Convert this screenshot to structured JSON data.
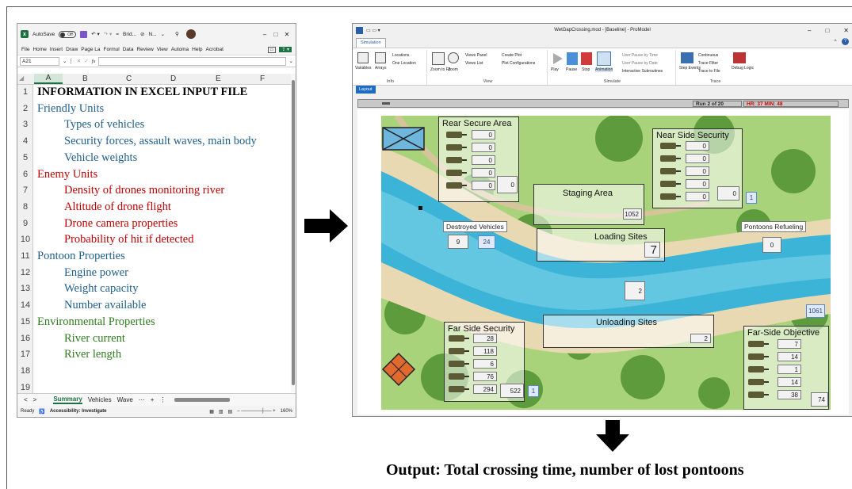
{
  "excel": {
    "title": {
      "autosave": "AutoSave",
      "autosave_state": "Off",
      "filename": "Brid...",
      "user": "N..."
    },
    "menu": [
      "File",
      "Home",
      "Insert",
      "Draw",
      "Page La",
      "Formul",
      "Data",
      "Review",
      "View",
      "Automa",
      "Help",
      "Acrobat"
    ],
    "name_box": "A21",
    "fx_label": "fx",
    "columns": [
      "A",
      "B",
      "C",
      "D",
      "E",
      "F"
    ],
    "rows": [
      "1",
      "2",
      "3",
      "4",
      "5",
      "6",
      "7",
      "8",
      "9",
      "10",
      "11",
      "12",
      "13",
      "14",
      "15",
      "16",
      "17",
      "18",
      "19"
    ],
    "cells": [
      {
        "text": "INFORMATION IN EXCEL INPUT FILE",
        "indent": 0,
        "color": "#000000",
        "bold": true
      },
      {
        "text": "Friendly Units",
        "indent": 0,
        "color": "#1f5f8b"
      },
      {
        "text": "Types of vehicles",
        "indent": 1,
        "color": "#1f5f8b"
      },
      {
        "text": "Security forces, assault waves, main body",
        "indent": 1,
        "color": "#1f5f8b"
      },
      {
        "text": "Vehicle weights",
        "indent": 1,
        "color": "#1f5f8b"
      },
      {
        "text": "Enemy Units",
        "indent": 0,
        "color": "#c00000"
      },
      {
        "text": "Density of drones monitoring river",
        "indent": 1,
        "color": "#c00000"
      },
      {
        "text": "Altitude of drone flight",
        "indent": 1,
        "color": "#c00000"
      },
      {
        "text": "Drone camera properties",
        "indent": 1,
        "color": "#c00000"
      },
      {
        "text": "Probability of hit if detected",
        "indent": 1,
        "color": "#c00000"
      },
      {
        "text": "Pontoon Properties",
        "indent": 0,
        "color": "#1f5f8b"
      },
      {
        "text": "Engine power",
        "indent": 1,
        "color": "#1f5f8b"
      },
      {
        "text": "Weight capacity",
        "indent": 1,
        "color": "#1f5f8b"
      },
      {
        "text": "Number available",
        "indent": 1,
        "color": "#1f5f8b"
      },
      {
        "text": "Environmental Properties",
        "indent": 0,
        "color": "#2e7d1e"
      },
      {
        "text": "River current",
        "indent": 1,
        "color": "#2e7d1e"
      },
      {
        "text": "River length",
        "indent": 1,
        "color": "#2e7d1e"
      }
    ],
    "sheet_tabs": [
      "Summary",
      "Vehicles",
      "Wave"
    ],
    "status": {
      "ready": "Ready",
      "accessibility": "Accessibility: Investigate",
      "zoom": "160%"
    }
  },
  "promodel": {
    "title": "WetGapCrossing.mod - [Baseline] - ProModel",
    "ribbon_tab": "Simulation",
    "groups": {
      "info": {
        "label": "Info",
        "items": [
          "Variables",
          "Arrays",
          "Locations",
          "One Location"
        ]
      },
      "view": {
        "label": "View",
        "items": [
          "Zoom to Fit",
          "Zoom",
          "Views Panel",
          "Views List",
          "Create Plot",
          "Plot Configurations"
        ]
      },
      "simulate": {
        "label": "Simulate",
        "items": [
          "Play",
          "Pause",
          "Stop",
          "Animation",
          "User Pause by Time",
          "User Pause by Date",
          "Interactive Subroutines"
        ]
      },
      "trace": {
        "label": "Trace",
        "items": [
          "Step Events",
          "Continuous",
          "Trace Filter",
          "Trace to File",
          "Debug Logic"
        ]
      }
    },
    "layout_tab": "Layout",
    "run": "Run 2 of 20",
    "clock": "HR: 37 MIN: 48",
    "areas": {
      "rear_secure": {
        "title": "Rear Secure Area",
        "counts": [
          "0",
          "0",
          "0",
          "0",
          "0"
        ],
        "total": "0"
      },
      "near_side": {
        "title": "Near Side Security",
        "counts": [
          "0",
          "0",
          "0",
          "0",
          "0"
        ],
        "total": "0",
        "badge": "1"
      },
      "staging": {
        "title": "Staging Area",
        "count": "1052"
      },
      "loading": {
        "title": "Loading Sites",
        "count": "7"
      },
      "destroyed": {
        "title": "Destroyed Vehicles",
        "a": "9",
        "b": "24"
      },
      "refueling": {
        "title": "Pontoons Refueling",
        "count": "0"
      },
      "river_count": "2",
      "right_count": "1061",
      "unloading": {
        "title": "Unloading Sites",
        "count": "2"
      },
      "far_side": {
        "title": "Far Side Security",
        "counts": [
          "28",
          "118",
          "6",
          "76",
          "294"
        ],
        "total": "522",
        "badge": "1"
      },
      "objective": {
        "title": "Far-Side Objective",
        "counts": [
          "7",
          "14",
          "1",
          "14",
          "38"
        ],
        "total": "74"
      }
    }
  },
  "output": "Output: Total crossing time,  number of lost pontoons"
}
